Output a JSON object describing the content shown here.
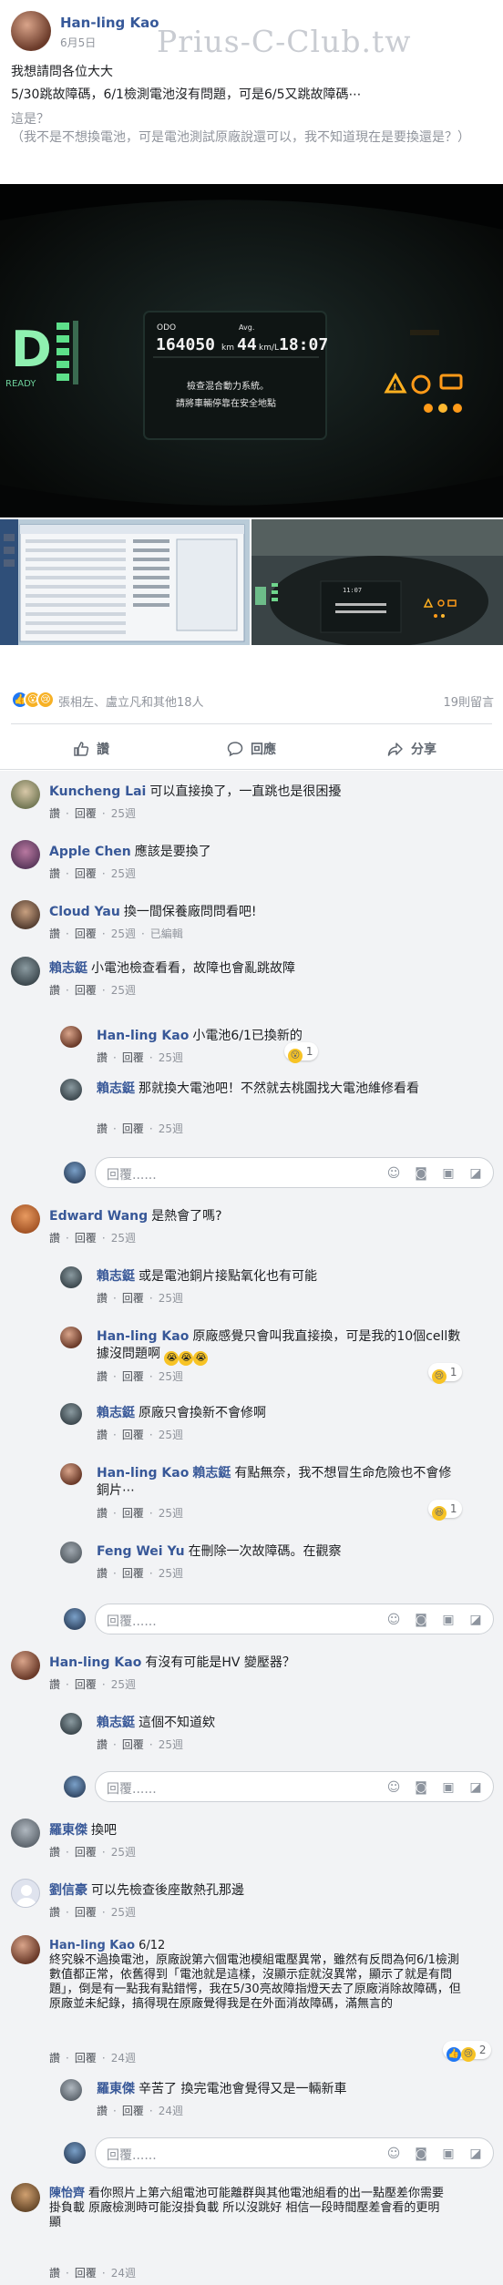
{
  "post": {
    "author": "Han-ling Kao",
    "date": "6月5日",
    "watermark": "Prius-C-Club.tw",
    "lines": [
      "我想請問各位大大",
      "5/30跳故障碼，6/1檢測電池沒有問題，可是6/5又跳故障碼⋯",
      "這是？",
      "（我不是不想換電池，可是電池測試原廠說還可以，我不知道現在是要換還是？）"
    ],
    "dashboard": {
      "odo_label": "ODO",
      "odo_value": "164050",
      "odo_unit": "km",
      "avg_label": "Avg.",
      "avg_value": "44",
      "avg_unit": "km/L",
      "time": "18:07",
      "gear": "D",
      "gear_mode": "READY",
      "warning_line1": "檢查混合動力系統。",
      "warning_line2": "請將車輛停靠在安全地點",
      "small_time": "11:07"
    }
  },
  "reactions": {
    "icons": [
      "like-icon",
      "wow-icon",
      "sad-icon"
    ],
    "text": "張相左、盧立凡和其他18人",
    "comments": "19則留言"
  },
  "actions": {
    "like": "讚",
    "reply": "回應",
    "share": "分享"
  },
  "ui": {
    "reply_placeholder": "回覆......",
    "like_action": "讚",
    "reply_action": "回覆",
    "edited": "已編輯"
  },
  "comments": [
    {
      "name": "Kuncheng Lai",
      "text": "可以直接換了，一直跳也是很困擾",
      "time": "25週"
    },
    {
      "name": "Apple Chen",
      "text": "應該是要換了",
      "time": "25週"
    },
    {
      "name": "Cloud Yau",
      "text": "換一間保養廠問問看吧!",
      "time": "25週",
      "edited": true
    },
    {
      "name": "賴志鋌",
      "text": "小電池檢查看看，故障也會亂跳故障",
      "time": "25週",
      "replies": [
        {
          "name": "Han-ling Kao",
          "text": "小電池6/1已換新的",
          "time": "25週",
          "reaction": "1"
        },
        {
          "name": "賴志鋌",
          "text": "那就換大電池吧！不然就去桃園找大電池維修看看",
          "time": "25週"
        }
      ]
    },
    {
      "name": "Edward Wang",
      "text": "是熱會了嗎?",
      "time": "25週",
      "replies": [
        {
          "name": "賴志鋌",
          "text": "或是電池銅片接點氧化也有可能",
          "time": "25週"
        },
        {
          "name": "Han-ling Kao",
          "text": "原廠感覺只會叫我直接換，可是我的10個cell數據沒問題啊",
          "time": "25週",
          "reaction": "1"
        },
        {
          "name": "賴志鋌",
          "text": "原廠只會換新不會修啊",
          "time": "25週"
        },
        {
          "name": "Han-ling Kao",
          "tag": "賴志鋌",
          "text": "有點無奈，我不想冒生命危險也不會修銅片⋯",
          "time": "25週",
          "reaction": "1"
        },
        {
          "name": "Feng Wei Yu",
          "text": "在刪除一次故障碼。在觀察",
          "time": "25週"
        }
      ]
    },
    {
      "name": "Han-ling Kao",
      "text": "有沒有可能是HV 變壓器？",
      "time": "25週",
      "replies": [
        {
          "name": "賴志鋌",
          "text": "這個不知道欸",
          "time": "25週"
        }
      ]
    },
    {
      "name": "羅東傑",
      "text": "換吧",
      "time": "25週"
    },
    {
      "name": "劉信豪",
      "text": "可以先檢查後座散熱孔那邊",
      "time": "25週"
    },
    {
      "name": "Han-ling Kao",
      "date_label": "6/12",
      "text": "終究躲不過換電池，原廠說第六個電池模組電壓異常，雖然有反問為何6/1檢測數值都正常，依舊得到「電池就是這樣，沒顯示症就沒異常，顯示了就是有問題」，倒是有一點我有點錯愕，我在5/30亮故障指燈天去了原廠消除故障碼，但原廠並未紀錄，搞得現在原廠覺得我是在外面消故障碼，滿無言的",
      "time": "24週",
      "reaction": "2",
      "replies": [
        {
          "name": "羅東傑",
          "text": "辛苦了 換完電池會覺得又是一輛新車",
          "time": "24週"
        }
      ]
    },
    {
      "name": "陳怡齊",
      "text": "看你照片上第六組電池可能離群與其他電池組看的出一點壓差你需要掛負載 原廠檢測時可能沒掛負載 所以沒跳好 相信一段時間壓差會看的更明顯",
      "time": "24週"
    }
  ]
}
